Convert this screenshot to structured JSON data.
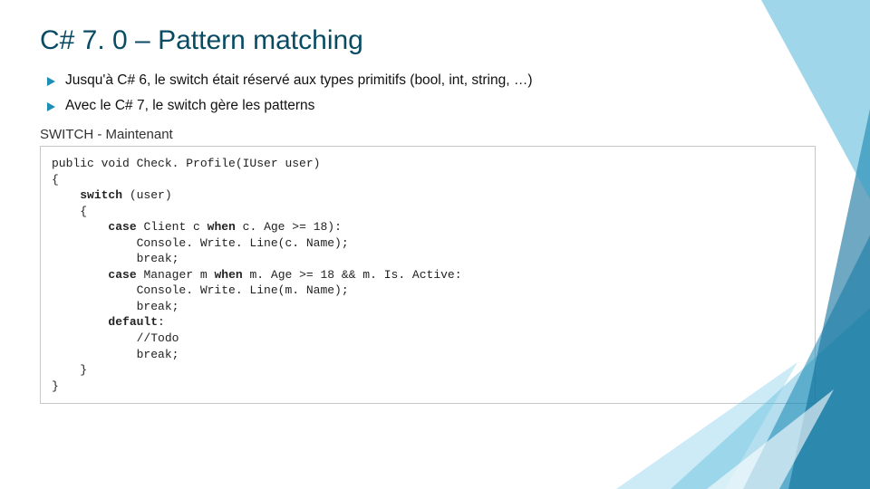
{
  "title": "C# 7. 0 – Pattern matching",
  "bullets": [
    "Jusqu'à C# 6, le switch était réservé aux types primitifs (bool, int, string, …)",
    "Avec le C# 7, le switch gère les patterns"
  ],
  "subhead": "SWITCH - Maintenant",
  "code": {
    "l1": "public void Check. Profile(IUser user)",
    "l2": "{",
    "l3a": "    ",
    "l3b": "switch",
    "l3c": " (user)",
    "l4": "    {",
    "l5a": "        ",
    "l5b": "case",
    "l5c": " Client c ",
    "l5d": "when",
    "l5e": " c. Age >= 18):",
    "l6": "            Console. Write. Line(c. Name);",
    "l7": "            break;",
    "l8a": "        ",
    "l8b": "case",
    "l8c": " Manager m ",
    "l8d": "when",
    "l8e": " m. Age >= 18 && m. Is. Active:",
    "l9": "            Console. Write. Line(m. Name);",
    "l10": "            break;",
    "l11a": "        ",
    "l11b": "default",
    "l11c": ":",
    "l12": "            //Todo",
    "l13": "            break;",
    "l14": "    }",
    "l15": "}"
  }
}
